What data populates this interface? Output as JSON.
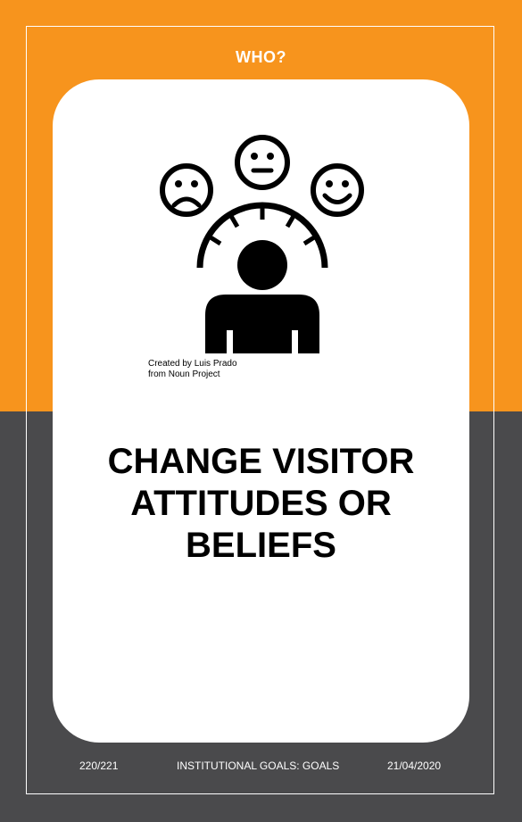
{
  "card": {
    "category": "WHO?",
    "title_lines": [
      "CHANGE VISITOR",
      "ATTITUDES OR",
      "BELIEFS"
    ],
    "credit_lines": [
      "Created by Luis Prado",
      "from Noun Project"
    ],
    "icon": "audience-attitude-gauge-icon"
  },
  "footer": {
    "page": "220/221",
    "section": "INSTITUTIONAL GOALS: GOALS",
    "date": "21/04/2020"
  },
  "colors": {
    "top_background": "#f7941d",
    "bottom_background": "#4a4a4c",
    "card": "#ffffff",
    "text_dark": "#000000"
  }
}
